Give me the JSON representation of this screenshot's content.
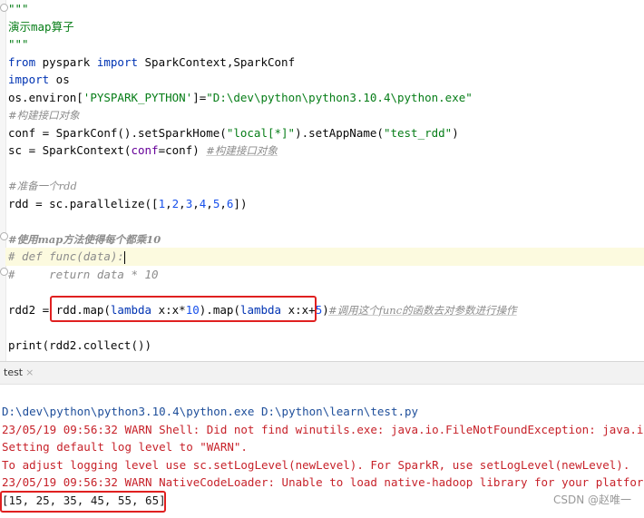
{
  "editor": {
    "lines": {
      "doc_open": "\"\"\"",
      "doc_text": "演示map算子",
      "doc_close": "\"\"\"",
      "l4_from": "from",
      "l4_mod": " pyspark ",
      "l4_import": "import",
      "l4_rest": " SparkContext,SparkConf",
      "l5_import": "import",
      "l5_rest": " os",
      "l6_a": "os.environ[",
      "l6_key": "'PYSPARK_PYTHON'",
      "l6_b": "]=",
      "l6_val": "\"D:\\dev\\python\\python3.10.4\\python.exe\"",
      "l7_comment": "#构建接口对象",
      "l8_a": "conf = SparkConf().setSparkHome(",
      "l8_s1": "\"local[*]\"",
      "l8_b": ").setAppName(",
      "l8_s2": "\"test_rdd\"",
      "l8_c": ")",
      "l9_a": "sc = SparkContext(",
      "l9_param": "conf",
      "l9_b": "=conf) ",
      "l9_comment": "#构建接口对象",
      "l11_comment": "#准备一个rdd",
      "l12_a": "rdd = sc.parallelize([",
      "l12_nums": [
        "1",
        "2",
        "3",
        "4",
        "5",
        "6"
      ],
      "l12_b": "])",
      "l14_comment": "#使用map方法使得每个都乘10",
      "l15_comment": "# def func(data):",
      "l16_comment": "#     return data * 10",
      "l18_a": "rdd2 = ",
      "l18_b": "rdd.map(",
      "l18_kw1": "lambda",
      "l18_c": " x:x*",
      "l18_n1": "10",
      "l18_d": ").map(",
      "l18_kw2": "lambda",
      "l18_e": " x:x+",
      "l18_n2": "5",
      "l18_f": ")",
      "l18_comment": "#调用这个func的函数去对参数进行操作",
      "l20": "print(rdd2.collect())"
    }
  },
  "run_panel": {
    "tab_label": "test",
    "tab_close": "×"
  },
  "console": {
    "cmd": "D:\\dev\\python\\python3.10.4\\python.exe D:\\python\\learn\\test.py",
    "warn1": "23/05/19 09:56:32 WARN Shell: Did not find winutils.exe: java.io.FileNotFoundException: java.io.File",
    "log_level": "Setting default log level to \"WARN\".",
    "adjust": "To adjust logging level use sc.setLogLevel(newLevel). For SparkR, use setLogLevel(newLevel).",
    "warn2": "23/05/19 09:56:32 WARN NativeCodeLoader: Unable to load native-hadoop library for your platform... u",
    "result": "[15, 25, 35, 45, 55, 65]"
  },
  "watermark": "CSDN @赵唯一",
  "colors": {
    "highlight_box": "#e02020",
    "string": "#067d17",
    "keyword": "#0033b3",
    "console_error": "#c7222a"
  }
}
